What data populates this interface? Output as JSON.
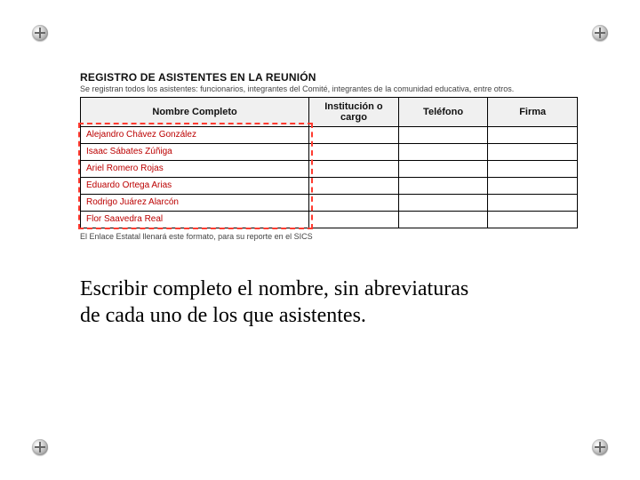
{
  "form": {
    "title": "REGISTRO DE ASISTENTES EN LA REUNIÓN",
    "subtitle": "Se registran todos los asistentes: funcionarios, integrantes del Comité, integrantes de la comunidad educativa, entre otros.",
    "columns": {
      "nombre": "Nombre Completo",
      "institucion": "Institución o cargo",
      "telefono": "Teléfono",
      "firma": "Firma"
    },
    "rows": [
      {
        "nombre": "Alejandro Chávez González"
      },
      {
        "nombre": "Isaac Sábates Zúñiga"
      },
      {
        "nombre": "Ariel Romero Rojas"
      },
      {
        "nombre": "Eduardo Ortega Arias"
      },
      {
        "nombre": "Rodrigo Juárez Alarcón"
      },
      {
        "nombre": "Flor Saavedra Real"
      }
    ],
    "footer": "El Enlace Estatal llenará este formato, para su reporte en el SICS"
  },
  "caption": {
    "line1": "Escribir completo el nombre, sin abreviaturas",
    "line2": "de cada uno de los que asistentes."
  }
}
